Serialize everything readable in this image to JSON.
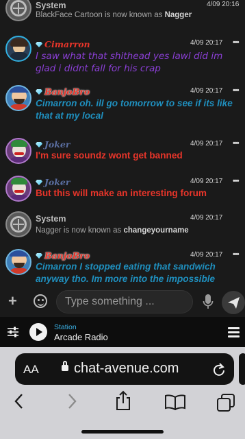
{
  "messages": [
    {
      "type": "system",
      "name": "System",
      "time": "4/09 20:16",
      "pre": "BlackFace Cartoon is now known as ",
      "bold": "Nagger"
    },
    {
      "type": "user",
      "name": "Cimarron",
      "name_color": "#e8352a",
      "time": "4/09 20:17",
      "text": "I saw what that shithead yes lawl did im glad i didnt fall for his crap",
      "text_color": "#8b3fd6"
    },
    {
      "type": "user",
      "name": "BanjoBro",
      "name_color": "#e8352a",
      "time": "4/09 20:17",
      "text": "Cimarron oh. ill go tomorrow to see if its like that at my local",
      "text_color": "#1f8fbe"
    },
    {
      "type": "user",
      "name": "Joker",
      "name_color": "#5a6ea0",
      "time": "4/09 20:17",
      "text": "I'm sure soundz wont get banned",
      "text_color": "#e8352a"
    },
    {
      "type": "user",
      "name": "Joker",
      "name_color": "#5a6ea0",
      "time": "4/09 20:17",
      "text": "But this will make an interesting forum",
      "text_color": "#e8352a"
    },
    {
      "type": "system",
      "name": "System",
      "time": "4/09 20:17",
      "pre": "Nagger is now known as ",
      "bold": "changeyourname"
    },
    {
      "type": "user",
      "name": "BanjoBro",
      "name_color": "#e8352a",
      "time": "4/09 20:17",
      "text": "Cimarron I stopped eating that sandwich anyway tho. Im more into the impossible",
      "text_color": "#1f8fbe"
    }
  ],
  "menu_glyph": "•••",
  "composer": {
    "placeholder": "Type something ...",
    "icons": [
      "plus-icon",
      "emoji-icon",
      "microphone-icon",
      "send-icon"
    ]
  },
  "radio": {
    "label": "Station",
    "name": "Arcade Radio",
    "icons": [
      "equalizer-icon",
      "play-icon",
      "hamburger-menu-icon"
    ]
  },
  "browser": {
    "text_size_label": "AA",
    "url": "chat-avenue.com",
    "icons": [
      "lock-icon",
      "reload-icon",
      "back-icon",
      "forward-icon",
      "share-icon",
      "bookmarks-icon",
      "tabs-icon"
    ]
  },
  "colors": {
    "link_blue": "#3cb3e8",
    "background": "#1a1a1a"
  }
}
